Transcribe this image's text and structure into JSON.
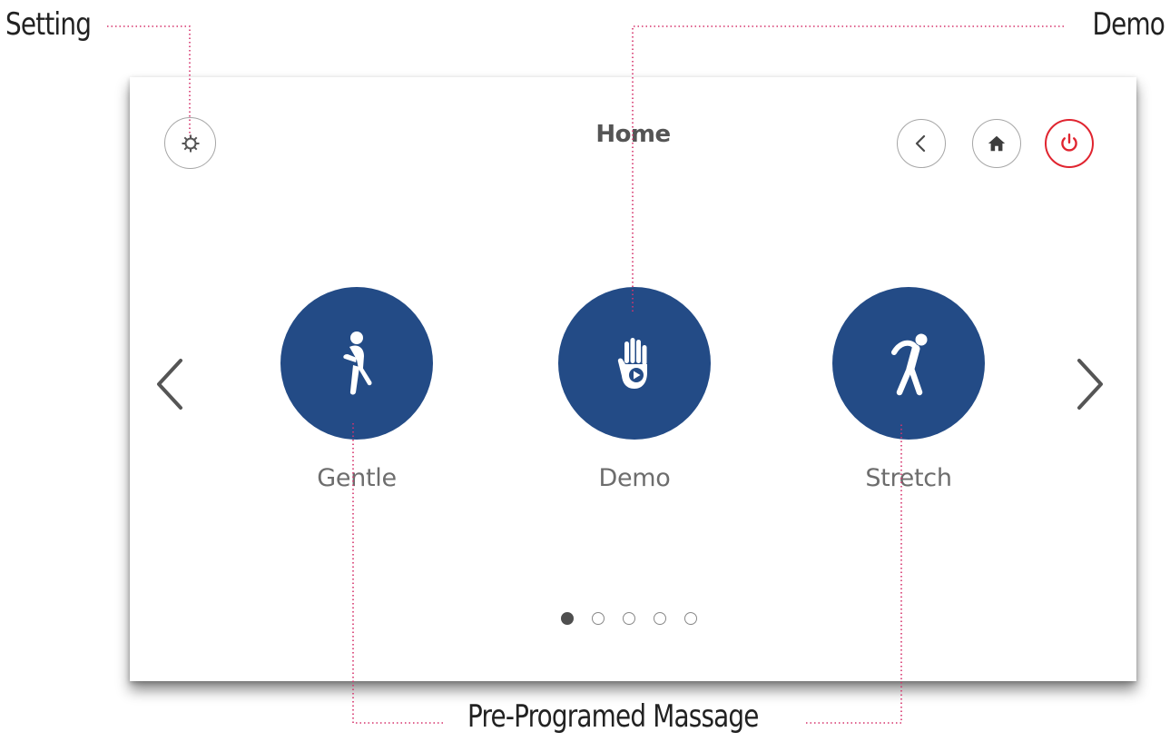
{
  "callouts": {
    "setting": "Setting",
    "demo": "Demo",
    "pre_programed": "Pre-Programed Massage"
  },
  "header": {
    "title": "Home"
  },
  "buttons": {
    "settings_icon": "gear-icon",
    "back_icon": "chevron-left-icon",
    "home_icon": "home-icon",
    "power_icon": "power-icon"
  },
  "programs": [
    {
      "label": "Gentle",
      "icon": "walking-person-icon"
    },
    {
      "label": "Demo",
      "icon": "hand-play-icon"
    },
    {
      "label": "Stretch",
      "icon": "stretching-person-icon"
    }
  ],
  "pagination": {
    "total": 5,
    "current": 1
  },
  "colors": {
    "program_circle": "#234b86",
    "power_accent": "#e0242f",
    "leader_line": "#d6336c"
  }
}
